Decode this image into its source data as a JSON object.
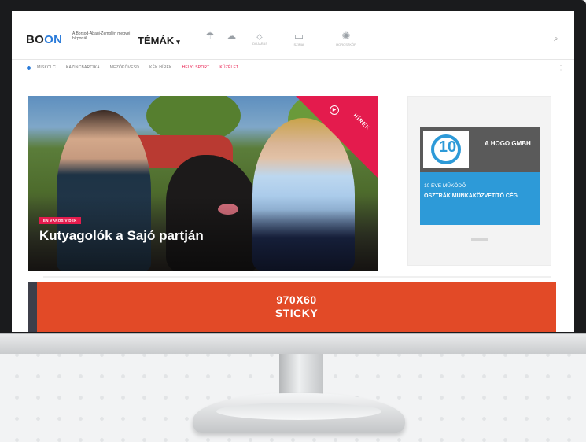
{
  "site": {
    "logo_main": "BO",
    "logo_accent": "ON",
    "tagline": "A Borsod-Abaúj-Zemplén megyei hírportál",
    "topics_label": "TÉMÁK",
    "header_icons": [
      {
        "name": "eso-icon",
        "caption": ""
      },
      {
        "name": "cloud-icon",
        "caption": ""
      },
      {
        "name": "weather-icon",
        "caption": "IDŐJÁRÁS"
      },
      {
        "name": "szinia-icon",
        "caption": "SZINIA"
      },
      {
        "name": "horoscope-icon",
        "caption": "HOROSZKÓP"
      }
    ]
  },
  "nav": {
    "items": [
      {
        "label": "MISKOLC",
        "hot": false
      },
      {
        "label": "KAZINCBARCIKA",
        "hot": false
      },
      {
        "label": "MEZŐKÖVESD",
        "hot": false
      },
      {
        "label": "KÉK HÍREK",
        "hot": false
      },
      {
        "label": "HELYI SPORT",
        "hot": true
      },
      {
        "label": "KÜZÉLET",
        "hot": true
      }
    ]
  },
  "hero": {
    "badge": "ÉN VÁROS VIDÉK",
    "headline": "Kutyagolók a Sajó partján",
    "ribbon_label": "HÍREK"
  },
  "ad": {
    "logo_number": "10",
    "company": "A HOGO GMBH",
    "line1": "10 ÉVE MŰKÖDŐ",
    "line2": "OSZTRÁK MUNKAKÖZVETÍTŐ CÉG"
  },
  "sticky": {
    "line1": "970X60",
    "line2": "STICKY"
  },
  "colors": {
    "brand_blue": "#2a7bd9",
    "accent_red": "#e41b4d",
    "sticky_orange": "#e24a27",
    "ad_blue": "#2d9ad8"
  }
}
